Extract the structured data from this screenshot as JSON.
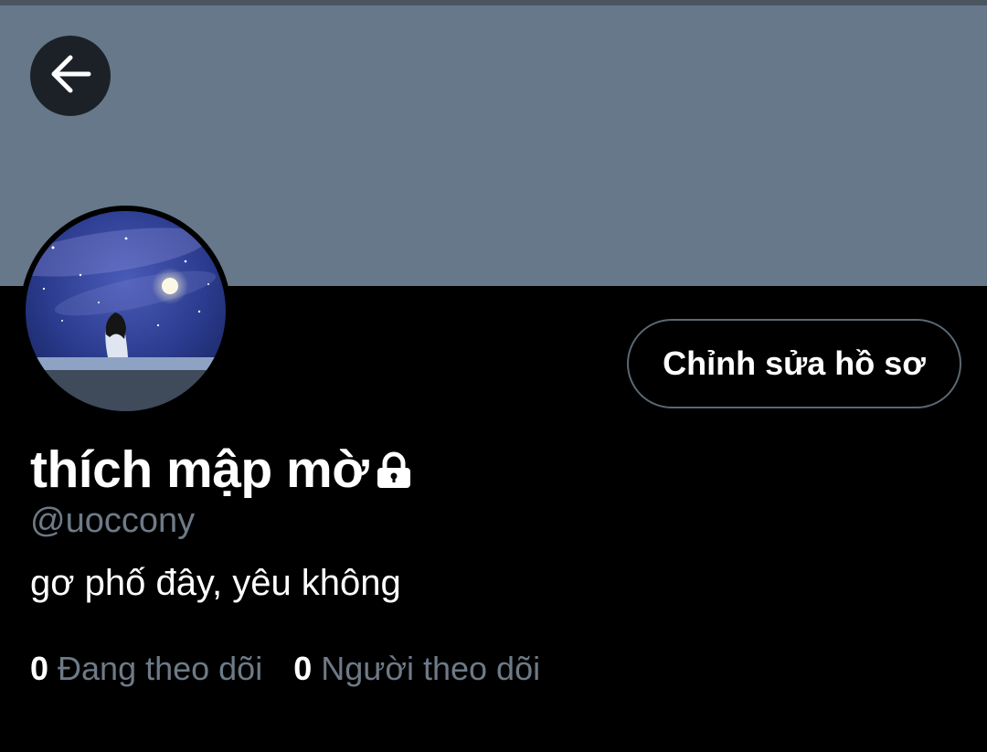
{
  "profile": {
    "display_name": "thích mập mờ",
    "handle": "@uoccony",
    "bio": "gơ phố đây, yêu không",
    "protected_icon": "lock-icon",
    "avatar_description": "avatar-image"
  },
  "header": {
    "back_icon": "arrow-left-icon",
    "banner_color": "#66788a"
  },
  "actions": {
    "edit_profile_label": "Chỉnh sửa hồ sơ"
  },
  "stats": {
    "following_count": "0",
    "following_label": "Đang theo dõi",
    "followers_count": "0",
    "followers_label": "Người theo dõi"
  },
  "colors": {
    "background": "#000000",
    "text_primary": "#ffffff",
    "text_secondary": "#6e7a87",
    "button_border": "#5b6873"
  }
}
